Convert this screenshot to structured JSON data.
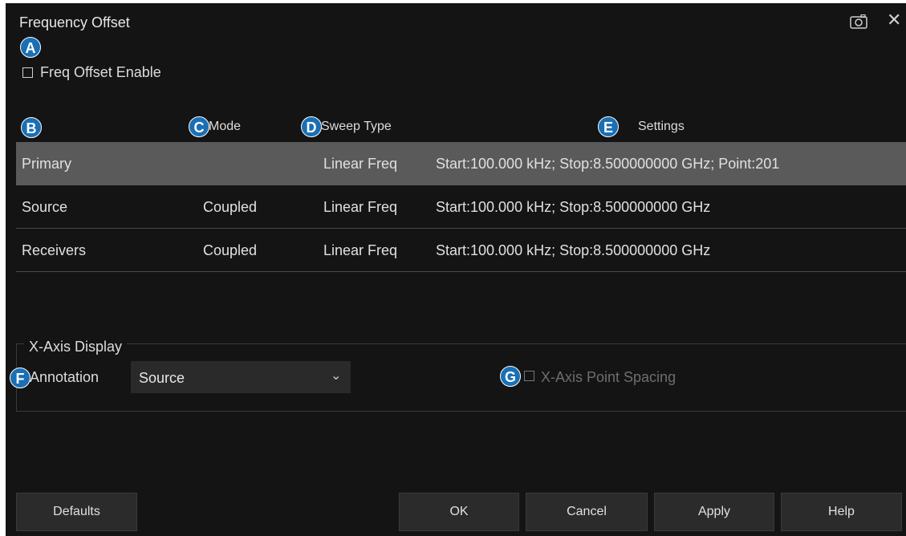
{
  "dialog": {
    "title": "Frequency Offset"
  },
  "badges": {
    "a": "A",
    "b": "B",
    "c": "C",
    "d": "D",
    "e": "E",
    "f": "F",
    "g": "G"
  },
  "freq_offset": {
    "label": "Freq Offset Enable",
    "checked": false
  },
  "table": {
    "headers": {
      "mode": "Mode",
      "sweep_type": "Sweep Type",
      "settings": "Settings"
    },
    "rows": [
      {
        "name": "Primary",
        "mode": "",
        "sweep_type": "Linear Freq",
        "settings": "Start:100.000 kHz; Stop:8.500000000 GHz; Point:201",
        "selected": true
      },
      {
        "name": "Source",
        "mode": "Coupled",
        "sweep_type": "Linear Freq",
        "settings": "Start:100.000 kHz; Stop:8.500000000 GHz",
        "selected": false
      },
      {
        "name": "Receivers",
        "mode": "Coupled",
        "sweep_type": "Linear Freq",
        "settings": "Start:100.000 kHz; Stop:8.500000000 GHz",
        "selected": false
      }
    ]
  },
  "xaxis": {
    "group_title": "X-Axis Display",
    "annotation_label": "Annotation",
    "annotation_value": "Source",
    "point_spacing_label": "X-Axis Point Spacing",
    "point_spacing_checked": false
  },
  "buttons": {
    "defaults": "Defaults",
    "ok": "OK",
    "cancel": "Cancel",
    "apply": "Apply",
    "help": "Help"
  },
  "icons": {
    "camera": "camera-icon",
    "close": "close-icon",
    "chevron": "chevron-down-icon"
  },
  "colors": {
    "background": "#141414",
    "selected_row": "#5a5a5a",
    "badge": "#1a6fb5"
  }
}
